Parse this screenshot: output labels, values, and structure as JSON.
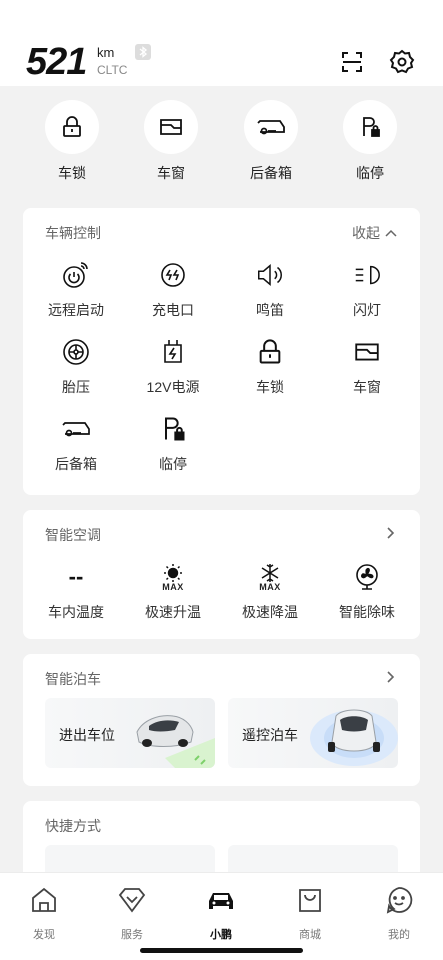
{
  "header": {
    "range_value": "521",
    "range_unit": "km",
    "range_standard": "CLTC"
  },
  "quick_actions": [
    {
      "label": "车锁",
      "icon": "lock-icon"
    },
    {
      "label": "车窗",
      "icon": "window-icon"
    },
    {
      "label": "后备箱",
      "icon": "trunk-icon"
    },
    {
      "label": "临停",
      "icon": "temp-park-icon"
    }
  ],
  "vehicle_control": {
    "title": "车辆控制",
    "collapse_label": "收起",
    "items": [
      {
        "label": "远程启动",
        "icon": "remote-start-icon"
      },
      {
        "label": "充电口",
        "icon": "charge-port-icon"
      },
      {
        "label": "鸣笛",
        "icon": "horn-icon"
      },
      {
        "label": "闪灯",
        "icon": "flash-lights-icon"
      },
      {
        "label": "胎压",
        "icon": "tire-pressure-icon"
      },
      {
        "label": "12V电源",
        "icon": "battery-12v-icon"
      },
      {
        "label": "车锁",
        "icon": "lock-icon"
      },
      {
        "label": "车窗",
        "icon": "window-icon"
      },
      {
        "label": "后备箱",
        "icon": "trunk-icon"
      },
      {
        "label": "临停",
        "icon": "temp-park-icon"
      }
    ]
  },
  "climate": {
    "title": "智能空调",
    "items": [
      {
        "label": "车内温度",
        "value": "--",
        "icon": "temperature-placeholder"
      },
      {
        "label": "极速升温",
        "badge": "MAX",
        "icon": "sun-icon"
      },
      {
        "label": "极速降温",
        "badge": "MAX",
        "icon": "snowflake-icon"
      },
      {
        "label": "智能除味",
        "icon": "fan-icon"
      }
    ]
  },
  "parking": {
    "title": "智能泊车",
    "tiles": [
      {
        "label": "进出车位"
      },
      {
        "label": "遥控泊车"
      }
    ]
  },
  "shortcuts": {
    "title": "快捷方式"
  },
  "nav": [
    {
      "label": "发现",
      "icon": "home-icon",
      "active": false
    },
    {
      "label": "服务",
      "icon": "service-icon",
      "active": false
    },
    {
      "label": "小鹏",
      "icon": "car-icon",
      "active": true
    },
    {
      "label": "商城",
      "icon": "shop-icon",
      "active": false
    },
    {
      "label": "我的",
      "icon": "profile-icon",
      "active": false
    }
  ],
  "colors": {
    "accent_green": "#7dd06a",
    "status_blue": "#3b8cf0",
    "status_orange": "#ff6a00"
  }
}
